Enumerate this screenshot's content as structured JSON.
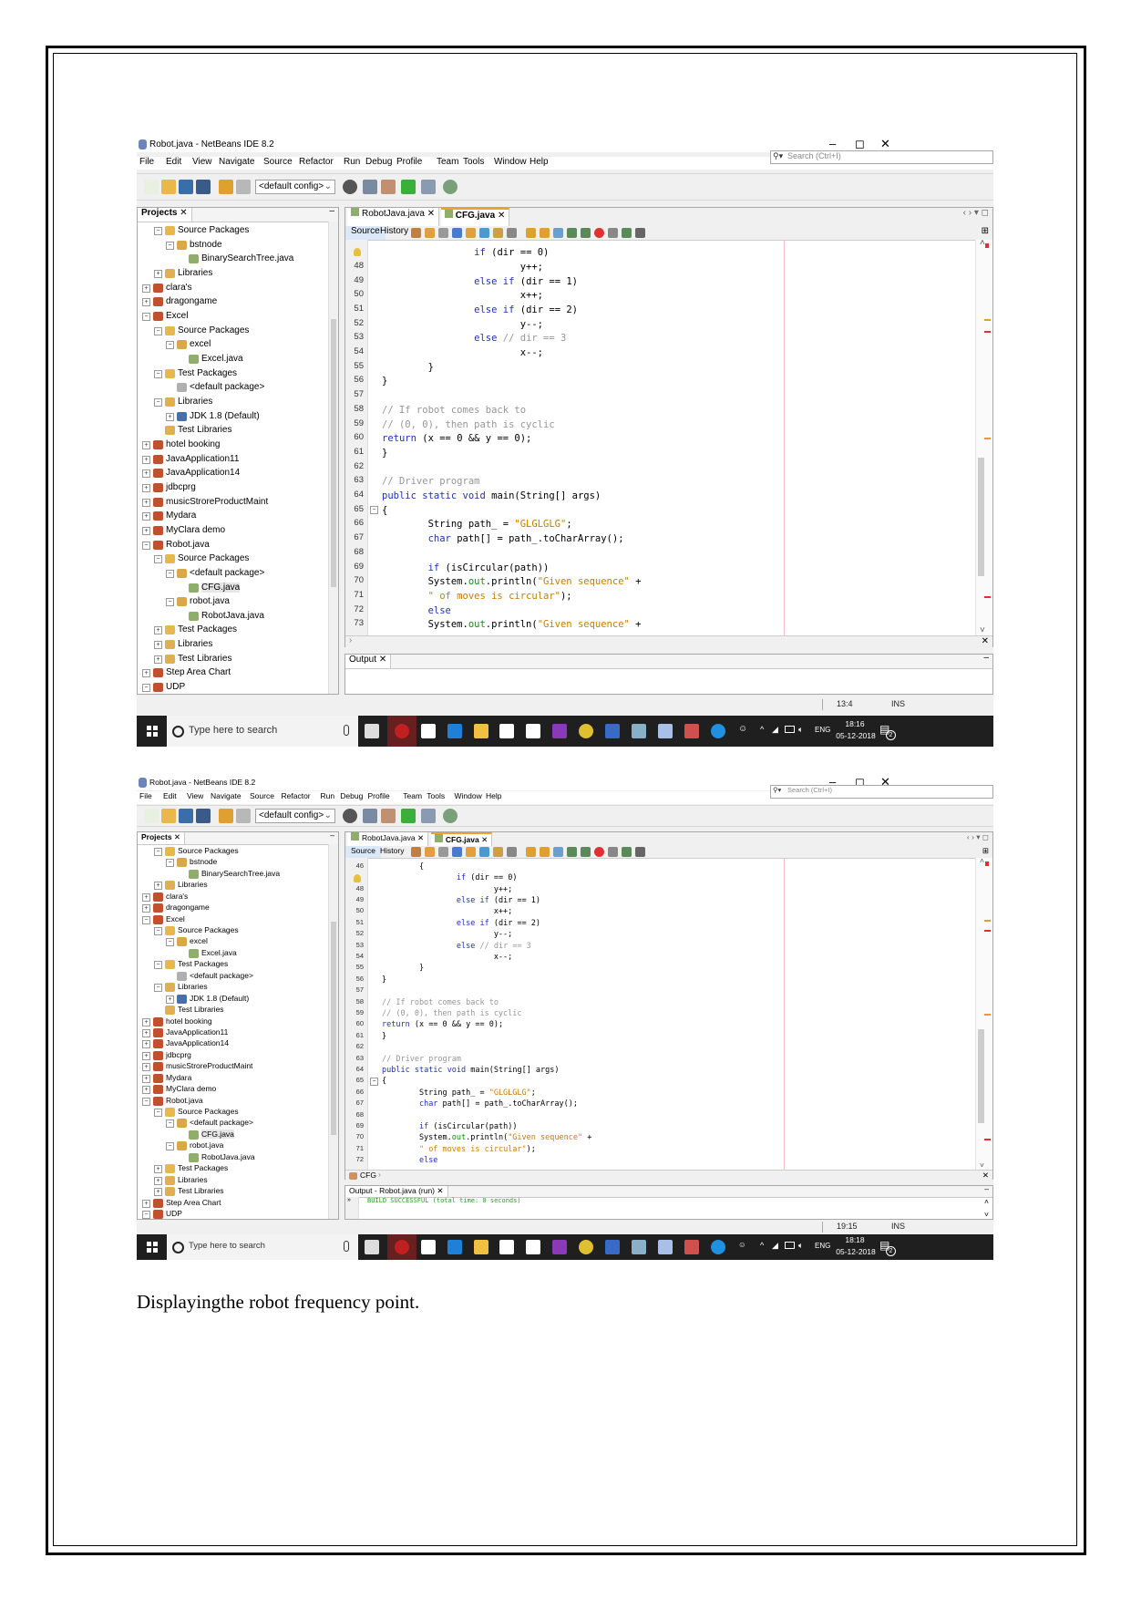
{
  "document": {
    "caption": "Displayingthe robot frequency point."
  },
  "colors": {
    "keyword": "#1f2fbf",
    "string": "#ce7b00",
    "comment": "#969696",
    "taskbar": "#1f1f1f",
    "active_tab": "#dbe8f8"
  },
  "screenshots": [
    {
      "window_title": "Robot.java - NetBeans IDE 8.2",
      "window_controls": [
        "–",
        "◻",
        "✕"
      ],
      "menu": [
        "File",
        "Edit",
        "View",
        "Navigate",
        "Source",
        "Refactor",
        "Run",
        "Debug",
        "Profile",
        "Team",
        "Tools",
        "Window",
        "Help"
      ],
      "search_placeholder": "Search (Ctrl+I)",
      "config_combo": "<default config>",
      "projects_tab": "Projects",
      "tree": [
        {
          "label": "Source Packages",
          "depth": 1,
          "exp": "-",
          "icon": "folder"
        },
        {
          "label": "bstnode",
          "depth": 2,
          "exp": "-",
          "icon": "package"
        },
        {
          "label": "BinarySearchTree.java",
          "depth": 3,
          "exp": "",
          "icon": "java-file"
        },
        {
          "label": "Libraries",
          "depth": 1,
          "exp": "+",
          "icon": "library"
        },
        {
          "label": "clara's",
          "depth": 0,
          "exp": "+",
          "icon": "project"
        },
        {
          "label": "dragongame",
          "depth": 0,
          "exp": "+",
          "icon": "project"
        },
        {
          "label": "Excel",
          "depth": 0,
          "exp": "-",
          "icon": "project"
        },
        {
          "label": "Source Packages",
          "depth": 1,
          "exp": "-",
          "icon": "folder"
        },
        {
          "label": "excel",
          "depth": 2,
          "exp": "-",
          "icon": "package"
        },
        {
          "label": "Excel.java",
          "depth": 3,
          "exp": "",
          "icon": "java-file"
        },
        {
          "label": "Test Packages",
          "depth": 1,
          "exp": "-",
          "icon": "folder"
        },
        {
          "label": "<default package>",
          "depth": 2,
          "exp": "",
          "icon": "empty-package"
        },
        {
          "label": "Libraries",
          "depth": 1,
          "exp": "-",
          "icon": "library"
        },
        {
          "label": "JDK 1.8 (Default)",
          "depth": 2,
          "exp": "+",
          "icon": "jdk"
        },
        {
          "label": "Test Libraries",
          "depth": 1,
          "exp": "",
          "icon": "library"
        },
        {
          "label": "hotel booking",
          "depth": 0,
          "exp": "+",
          "icon": "project"
        },
        {
          "label": "JavaApplication11",
          "depth": 0,
          "exp": "+",
          "icon": "project"
        },
        {
          "label": "JavaApplication14",
          "depth": 0,
          "exp": "+",
          "icon": "project"
        },
        {
          "label": "jdbcprg",
          "depth": 0,
          "exp": "+",
          "icon": "project"
        },
        {
          "label": "musicStroreProductMaint",
          "depth": 0,
          "exp": "+",
          "icon": "project"
        },
        {
          "label": "Mydara",
          "depth": 0,
          "exp": "+",
          "icon": "project"
        },
        {
          "label": "MyClara demo",
          "depth": 0,
          "exp": "+",
          "icon": "project"
        },
        {
          "label": "Robot.java",
          "depth": 0,
          "exp": "-",
          "icon": "project"
        },
        {
          "label": "Source Packages",
          "depth": 1,
          "exp": "-",
          "icon": "folder"
        },
        {
          "label": "<default package>",
          "depth": 2,
          "exp": "-",
          "icon": "package"
        },
        {
          "label": "CFG.java",
          "depth": 3,
          "exp": "",
          "icon": "java-file",
          "selected": true
        },
        {
          "label": "robot.java",
          "depth": 2,
          "exp": "-",
          "icon": "package"
        },
        {
          "label": "RobotJava.java",
          "depth": 3,
          "exp": "",
          "icon": "java-file"
        },
        {
          "label": "Test Packages",
          "depth": 1,
          "exp": "+",
          "icon": "folder"
        },
        {
          "label": "Libraries",
          "depth": 1,
          "exp": "+",
          "icon": "library"
        },
        {
          "label": "Test Libraries",
          "depth": 1,
          "exp": "+",
          "icon": "library"
        },
        {
          "label": "Step Area Chart",
          "depth": 0,
          "exp": "+",
          "icon": "project"
        },
        {
          "label": "UDP",
          "depth": 0,
          "exp": "-",
          "icon": "project"
        }
      ],
      "editor_tabs": [
        {
          "label": "RobotJava.java",
          "active": false
        },
        {
          "label": "CFG.java",
          "active": true
        }
      ],
      "source_tab": "Source",
      "history_tab": "History",
      "code": [
        {
          "n": "47",
          "hint": true,
          "text": "                if (dir == 0)"
        },
        {
          "n": "48",
          "text": "                        y++;"
        },
        {
          "n": "49",
          "text": "                else if (dir == 1)"
        },
        {
          "n": "50",
          "text": "                        x++;"
        },
        {
          "n": "51",
          "text": "                else if (dir == 2)"
        },
        {
          "n": "52",
          "text": "                        y--;"
        },
        {
          "n": "53",
          "text": "                else // dir == 3"
        },
        {
          "n": "54",
          "text": "                        x--;"
        },
        {
          "n": "55",
          "text": "        }"
        },
        {
          "n": "56",
          "text": "}"
        },
        {
          "n": "57",
          "text": ""
        },
        {
          "n": "58",
          "text": "// If robot comes back to"
        },
        {
          "n": "59",
          "text": "// (0, 0), then path is cyclic"
        },
        {
          "n": "60",
          "text": "return (x == 0 && y == 0);"
        },
        {
          "n": "61",
          "text": "}"
        },
        {
          "n": "62",
          "text": ""
        },
        {
          "n": "63",
          "text": "// Driver program"
        },
        {
          "n": "64",
          "text": "public static void main(String[] args)"
        },
        {
          "n": "65",
          "fold": true,
          "text": "{"
        },
        {
          "n": "66",
          "text": "        String path_ = \"GLGLGLG\";"
        },
        {
          "n": "67",
          "text": "        char path[] = path_.toCharArray();"
        },
        {
          "n": "68",
          "text": ""
        },
        {
          "n": "69",
          "text": "        if (isCircular(path))"
        },
        {
          "n": "70",
          "text": "        System.out.println(\"Given sequence\" +"
        },
        {
          "n": "71",
          "text": "        \" of moves is circular\");"
        },
        {
          "n": "72",
          "text": "        else"
        },
        {
          "n": "73",
          "text": "        System.out.println(\"Given sequence\" +"
        }
      ],
      "breadcrumb": "",
      "output_tab": "Output",
      "output_lines": [],
      "status_position": "13:4",
      "status_mode": "INS",
      "taskbar": {
        "search_placeholder": "Type here to search",
        "language": "ENG",
        "time": "18:16",
        "date": "05-12-2018",
        "notifications": "2"
      }
    },
    {
      "window_title": "Robot.java - NetBeans IDE 8.2",
      "window_controls": [
        "–",
        "◻",
        "✕"
      ],
      "menu": [
        "File",
        "Edit",
        "View",
        "Navigate",
        "Source",
        "Refactor",
        "Run",
        "Debug",
        "Profile",
        "Team",
        "Tools",
        "Window",
        "Help"
      ],
      "search_placeholder": "Search (Ctrl+I)",
      "config_combo": "<default config>",
      "projects_tab": "Projects",
      "tree": [
        {
          "label": "Source Packages",
          "depth": 1,
          "exp": "-",
          "icon": "folder"
        },
        {
          "label": "bstnode",
          "depth": 2,
          "exp": "-",
          "icon": "package"
        },
        {
          "label": "BinarySearchTree.java",
          "depth": 3,
          "exp": "",
          "icon": "java-file"
        },
        {
          "label": "Libraries",
          "depth": 1,
          "exp": "+",
          "icon": "library"
        },
        {
          "label": "clara's",
          "depth": 0,
          "exp": "+",
          "icon": "project"
        },
        {
          "label": "dragongame",
          "depth": 0,
          "exp": "+",
          "icon": "project"
        },
        {
          "label": "Excel",
          "depth": 0,
          "exp": "-",
          "icon": "project"
        },
        {
          "label": "Source Packages",
          "depth": 1,
          "exp": "-",
          "icon": "folder"
        },
        {
          "label": "excel",
          "depth": 2,
          "exp": "-",
          "icon": "package"
        },
        {
          "label": "Excel.java",
          "depth": 3,
          "exp": "",
          "icon": "java-file"
        },
        {
          "label": "Test Packages",
          "depth": 1,
          "exp": "-",
          "icon": "folder"
        },
        {
          "label": "<default package>",
          "depth": 2,
          "exp": "",
          "icon": "empty-package"
        },
        {
          "label": "Libraries",
          "depth": 1,
          "exp": "-",
          "icon": "library"
        },
        {
          "label": "JDK 1.8 (Default)",
          "depth": 2,
          "exp": "+",
          "icon": "jdk"
        },
        {
          "label": "Test Libraries",
          "depth": 1,
          "exp": "",
          "icon": "library"
        },
        {
          "label": "hotel booking",
          "depth": 0,
          "exp": "+",
          "icon": "project"
        },
        {
          "label": "JavaApplication11",
          "depth": 0,
          "exp": "+",
          "icon": "project"
        },
        {
          "label": "JavaApplication14",
          "depth": 0,
          "exp": "+",
          "icon": "project"
        },
        {
          "label": "jdbcprg",
          "depth": 0,
          "exp": "+",
          "icon": "project"
        },
        {
          "label": "musicStroreProductMaint",
          "depth": 0,
          "exp": "+",
          "icon": "project"
        },
        {
          "label": "Mydara",
          "depth": 0,
          "exp": "+",
          "icon": "project"
        },
        {
          "label": "MyClara demo",
          "depth": 0,
          "exp": "+",
          "icon": "project"
        },
        {
          "label": "Robot.java",
          "depth": 0,
          "exp": "-",
          "icon": "project"
        },
        {
          "label": "Source Packages",
          "depth": 1,
          "exp": "-",
          "icon": "folder"
        },
        {
          "label": "<default package>",
          "depth": 2,
          "exp": "-",
          "icon": "package"
        },
        {
          "label": "CFG.java",
          "depth": 3,
          "exp": "",
          "icon": "java-file",
          "selected": true
        },
        {
          "label": "robot.java",
          "depth": 2,
          "exp": "-",
          "icon": "package"
        },
        {
          "label": "RobotJava.java",
          "depth": 3,
          "exp": "",
          "icon": "java-file"
        },
        {
          "label": "Test Packages",
          "depth": 1,
          "exp": "+",
          "icon": "folder"
        },
        {
          "label": "Libraries",
          "depth": 1,
          "exp": "+",
          "icon": "library"
        },
        {
          "label": "Test Libraries",
          "depth": 1,
          "exp": "+",
          "icon": "library"
        },
        {
          "label": "Step Area Chart",
          "depth": 0,
          "exp": "+",
          "icon": "project"
        },
        {
          "label": "UDP",
          "depth": 0,
          "exp": "-",
          "icon": "project"
        }
      ],
      "editor_tabs": [
        {
          "label": "RobotJava.java",
          "active": false
        },
        {
          "label": "CFG.java",
          "active": true
        }
      ],
      "source_tab": "Source",
      "history_tab": "History",
      "code": [
        {
          "n": "46",
          "text": "        {"
        },
        {
          "n": "47",
          "hint": true,
          "text": "                if (dir == 0)"
        },
        {
          "n": "48",
          "text": "                        y++;"
        },
        {
          "n": "49",
          "text": "                else if (dir == 1)"
        },
        {
          "n": "50",
          "text": "                        x++;"
        },
        {
          "n": "51",
          "text": "                else if (dir == 2)"
        },
        {
          "n": "52",
          "text": "                        y--;"
        },
        {
          "n": "53",
          "text": "                else // dir == 3"
        },
        {
          "n": "54",
          "text": "                        x--;"
        },
        {
          "n": "55",
          "text": "        }"
        },
        {
          "n": "56",
          "text": "}"
        },
        {
          "n": "57",
          "text": ""
        },
        {
          "n": "58",
          "text": "// If robot comes back to"
        },
        {
          "n": "59",
          "text": "// (0, 0), then path is cyclic"
        },
        {
          "n": "60",
          "text": "return (x == 0 && y == 0);"
        },
        {
          "n": "61",
          "text": "}"
        },
        {
          "n": "62",
          "text": ""
        },
        {
          "n": "63",
          "text": "// Driver program"
        },
        {
          "n": "64",
          "text": "public static void main(String[] args)"
        },
        {
          "n": "65",
          "fold": true,
          "text": "{"
        },
        {
          "n": "66",
          "text": "        String path_ = \"GLGLGLG\";"
        },
        {
          "n": "67",
          "text": "        char path[] = path_.toCharArray();"
        },
        {
          "n": "68",
          "text": ""
        },
        {
          "n": "69",
          "text": "        if (isCircular(path))"
        },
        {
          "n": "70",
          "text": "        System.out.println(\"Given sequence\" +"
        },
        {
          "n": "71",
          "text": "        \" of moves is circular\");"
        },
        {
          "n": "72",
          "text": "        else"
        }
      ],
      "breadcrumb": "CFG",
      "output_tab": "Output - Robot.java (run)",
      "output_lines": [
        "BUILD SUCCESSFUL (total time: 0 seconds)"
      ],
      "status_position": "19:15",
      "status_mode": "INS",
      "taskbar": {
        "search_placeholder": "Type here to search",
        "language": "ENG",
        "time": "18:18",
        "date": "05-12-2018",
        "notifications": "2"
      }
    }
  ]
}
